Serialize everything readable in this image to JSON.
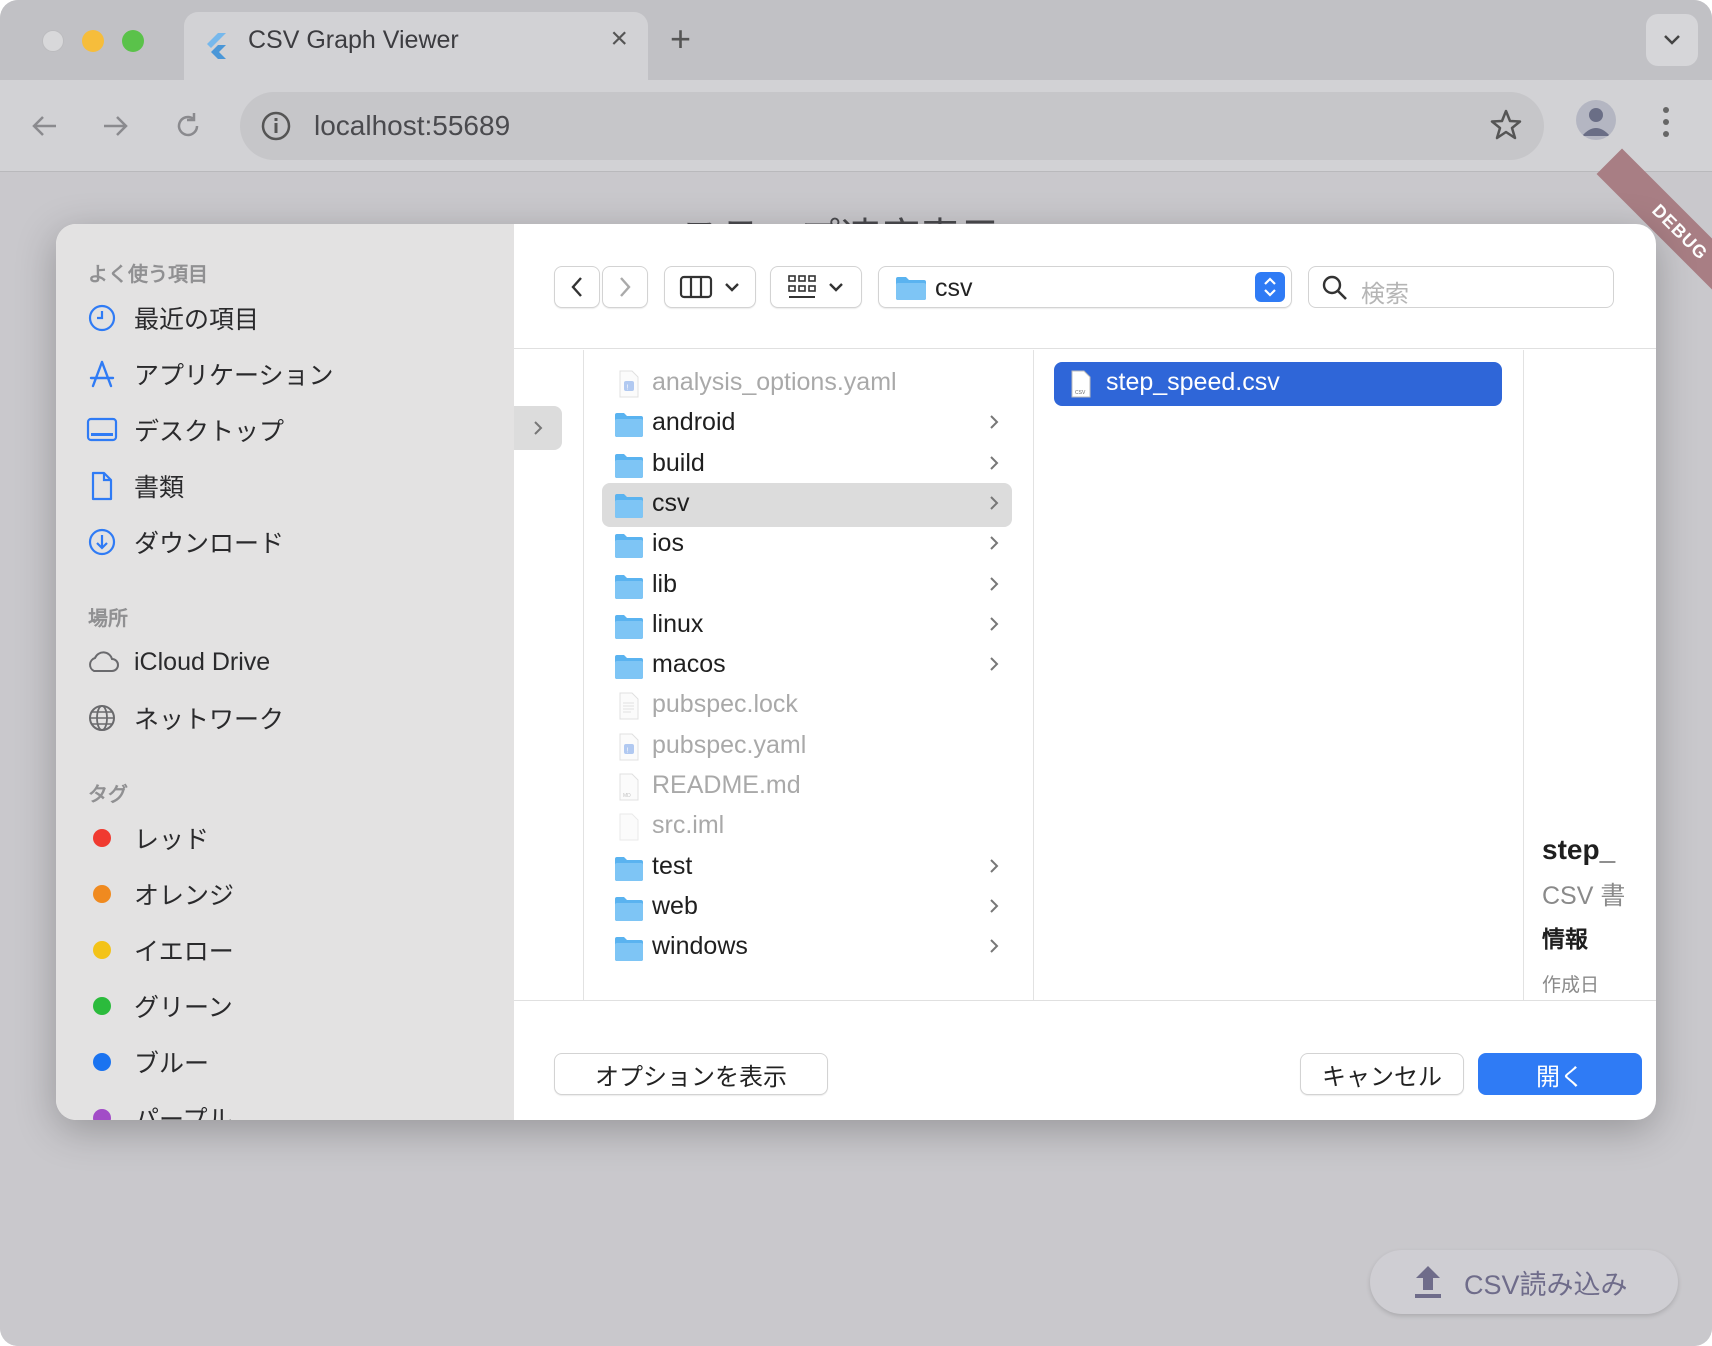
{
  "browser": {
    "tab_title": "CSV Graph Viewer",
    "url": "localhost:55689"
  },
  "page": {
    "title_partial": "ステップ速度表示",
    "debug_label": "DEBUG",
    "fab_label": "CSV読み込み"
  },
  "sidebar": {
    "favorites_header": "よく使う項目",
    "favorites": [
      {
        "label": "最近の項目",
        "icon": "clock-icon"
      },
      {
        "label": "アプリケーション",
        "icon": "applications-icon"
      },
      {
        "label": "デスクトップ",
        "icon": "desktop-icon"
      },
      {
        "label": "書類",
        "icon": "document-icon"
      },
      {
        "label": "ダウンロード",
        "icon": "download-icon"
      }
    ],
    "locations_header": "場所",
    "locations": [
      {
        "label": "iCloud Drive",
        "icon": "cloud-icon"
      },
      {
        "label": "ネットワーク",
        "icon": "network-globe-icon"
      }
    ],
    "tags_header": "タグ",
    "tags": [
      {
        "label": "レッド",
        "color": "#f03a30"
      },
      {
        "label": "オレンジ",
        "color": "#f08a1f"
      },
      {
        "label": "イエロー",
        "color": "#f3c318"
      },
      {
        "label": "グリーン",
        "color": "#2bbb3c"
      },
      {
        "label": "ブルー",
        "color": "#1a73f0"
      },
      {
        "label": "パープル",
        "color": "#a24cc7"
      }
    ]
  },
  "toolbar": {
    "current_folder": "csv",
    "search_placeholder": "検索"
  },
  "column1": [
    {
      "label": "analysis_options.yaml",
      "kind": "yaml-file",
      "enabled": false
    },
    {
      "label": "android",
      "kind": "folder",
      "enabled": true
    },
    {
      "label": "build",
      "kind": "folder",
      "enabled": true
    },
    {
      "label": "csv",
      "kind": "folder",
      "enabled": true,
      "selected": true
    },
    {
      "label": "ios",
      "kind": "folder",
      "enabled": true
    },
    {
      "label": "lib",
      "kind": "folder",
      "enabled": true
    },
    {
      "label": "linux",
      "kind": "folder",
      "enabled": true
    },
    {
      "label": "macos",
      "kind": "folder",
      "enabled": true
    },
    {
      "label": "pubspec.lock",
      "kind": "text-file",
      "enabled": false
    },
    {
      "label": "pubspec.yaml",
      "kind": "yaml-file",
      "enabled": false
    },
    {
      "label": "README.md",
      "kind": "md-file",
      "enabled": false
    },
    {
      "label": "src.iml",
      "kind": "blank-file",
      "enabled": false
    },
    {
      "label": "test",
      "kind": "folder",
      "enabled": true
    },
    {
      "label": "web",
      "kind": "folder",
      "enabled": true
    },
    {
      "label": "windows",
      "kind": "folder",
      "enabled": true
    }
  ],
  "column2": [
    {
      "label": "step_speed.csv",
      "kind": "csv-file",
      "selected": true
    }
  ],
  "preview": {
    "name": "step_",
    "kind": "CSV 書",
    "info_header": "情報",
    "created_label": "作成日"
  },
  "buttons": {
    "options": "オプションを表示",
    "cancel": "キャンセル",
    "open": "開く"
  },
  "colors": {
    "accent": "#2f7bf5",
    "selection": "#2f66d8",
    "folder": "#5ab3f0"
  }
}
